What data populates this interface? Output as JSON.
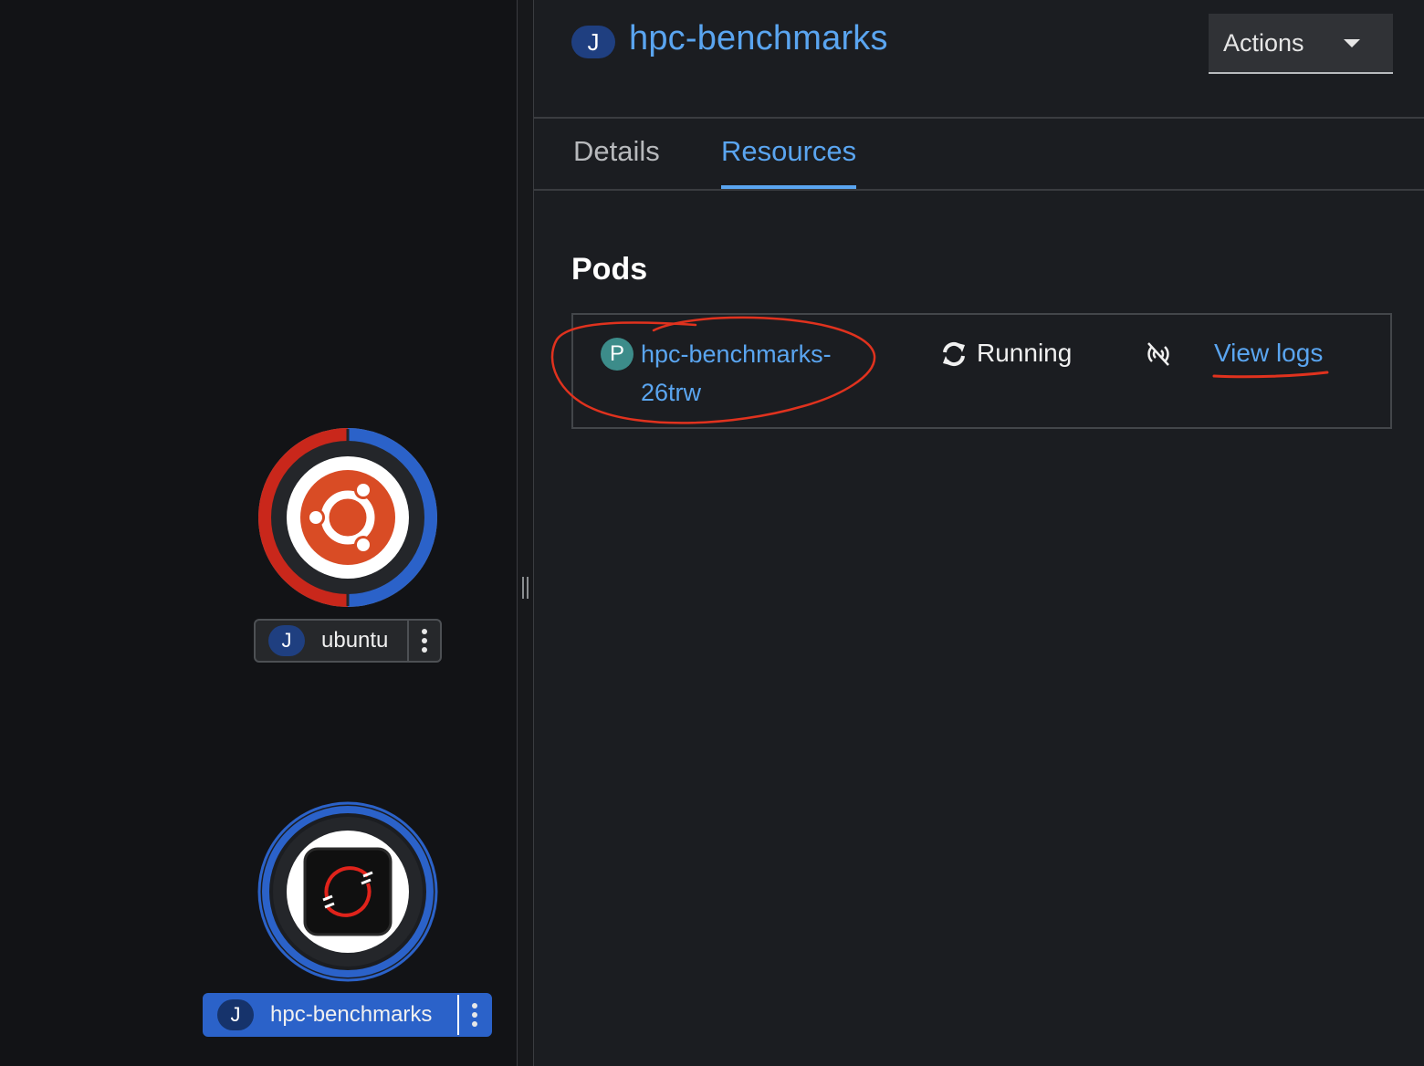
{
  "topology": {
    "nodes": [
      {
        "name": "ubuntu",
        "badge": "J",
        "logo": "ubuntu-logo",
        "ring_colors": [
          "#c9271b",
          "#2b62c9"
        ]
      },
      {
        "name": "hpc-benchmarks",
        "badge": "J",
        "logo": "openshift-logo",
        "ring_colors": [
          "#2b62c9"
        ],
        "selected": true
      }
    ]
  },
  "panel": {
    "title_badge": "J",
    "title": "hpc-benchmarks",
    "actions_label": "Actions",
    "tabs": [
      {
        "label": "Details",
        "active": false
      },
      {
        "label": "Resources",
        "active": true
      }
    ],
    "section_title": "Pods",
    "pod": {
      "badge": "P",
      "name": "hpc-benchmarks-26trw",
      "status": "Running",
      "status_icon": "sync-icon",
      "network_icon": "unlinked-icon",
      "view_logs": "View logs"
    }
  },
  "colors": {
    "link": "#5aa5f0",
    "annotation": "#e0321e",
    "selected_node": "#2b62c9"
  }
}
